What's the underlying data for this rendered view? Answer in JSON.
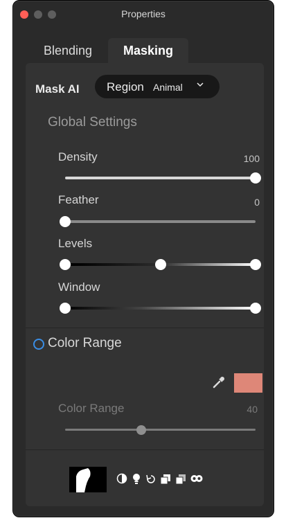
{
  "window": {
    "title": "Properties"
  },
  "tabs": [
    {
      "label": "Blending",
      "active": false
    },
    {
      "label": "Masking",
      "active": true
    }
  ],
  "mask_ai": {
    "label": "Mask AI",
    "mode_label": "Region",
    "mode_value": "Animal"
  },
  "global_settings": {
    "title": "Global Settings",
    "density": {
      "label": "Density",
      "value": "100"
    },
    "feather": {
      "label": "Feather",
      "value": "0"
    },
    "levels": {
      "label": "Levels",
      "low": 0,
      "mid": 0.5,
      "high": 1
    },
    "window": {
      "label": "Window",
      "low": 0,
      "high": 1
    }
  },
  "color_range": {
    "title": "Color Range",
    "swatch_color": "#de8778",
    "slider_label": "Color Range",
    "slider_value": "40",
    "slider_fraction": 0.4
  },
  "colors": {
    "accent_blue": "#3a8ee6",
    "close_red": "#ff5f57"
  },
  "bottom_icons": [
    "mask-thumbnail",
    "contrast-icon",
    "lightbulb-icon",
    "undo-icon",
    "copy-layer-icon",
    "paste-layer-icon",
    "overlay-icon"
  ]
}
